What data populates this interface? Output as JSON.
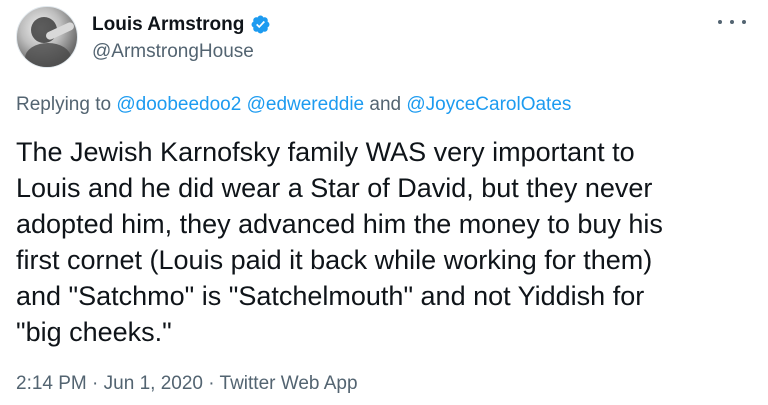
{
  "author": {
    "display_name": "Louis Armstrong",
    "handle": "@ArmstrongHouse",
    "verified": true,
    "verified_color": "#1d9bf0"
  },
  "reply": {
    "prefix": "Replying to",
    "user1": "@doobeedoo2",
    "user2": "@edwereddie",
    "conjunction": "and",
    "user3": "@JoyceCarolOates"
  },
  "tweet_text": "The Jewish Karnofsky family WAS very important to\nLouis and he did wear a Star of David, but they never\nadopted him, they advanced him the money to buy his\nfirst cornet (Louis paid it back while working for them)\nand \"Satchmo\" is \"Satchelmouth\" and not Yiddish for\n\"big cheeks.\"",
  "meta": {
    "time": "2:14 PM",
    "separator1": "·",
    "date": "Jun 1, 2020",
    "separator2": "·",
    "source": "Twitter Web App"
  },
  "icons": {
    "more": "more-options-icon",
    "verified": "verified-badge-icon"
  }
}
